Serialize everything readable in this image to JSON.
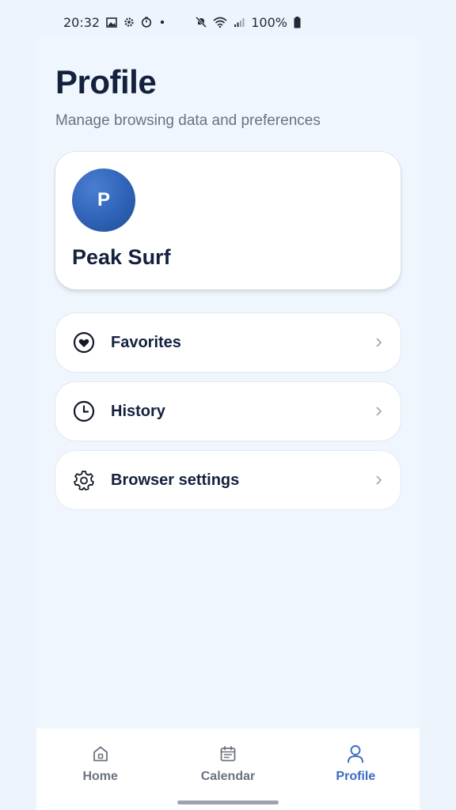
{
  "status_bar": {
    "time": "20:32",
    "left_icons": [
      "gallery-icon",
      "settings-icon",
      "timer-icon",
      "dot-icon"
    ],
    "right_icons": [
      "mute-icon",
      "wifi-icon",
      "signal-icon"
    ],
    "battery": "100%"
  },
  "header": {
    "title": "Profile",
    "subtitle": "Manage browsing data and preferences"
  },
  "profile": {
    "initial": "P",
    "name": "Peak Surf",
    "avatar_color": "#2f63b8"
  },
  "menu": [
    {
      "label": "Favorites",
      "icon": "heart-icon"
    },
    {
      "label": "History",
      "icon": "clock-icon"
    },
    {
      "label": "Browser settings",
      "icon": "gear-icon"
    }
  ],
  "bottom_nav": {
    "items": [
      {
        "label": "Home",
        "icon": "home-icon",
        "active": false
      },
      {
        "label": "Calendar",
        "icon": "calendar-icon",
        "active": false
      },
      {
        "label": "Profile",
        "icon": "user-icon",
        "active": true
      }
    ],
    "active_color": "#3b6cc0",
    "inactive_color": "#6b7280"
  }
}
